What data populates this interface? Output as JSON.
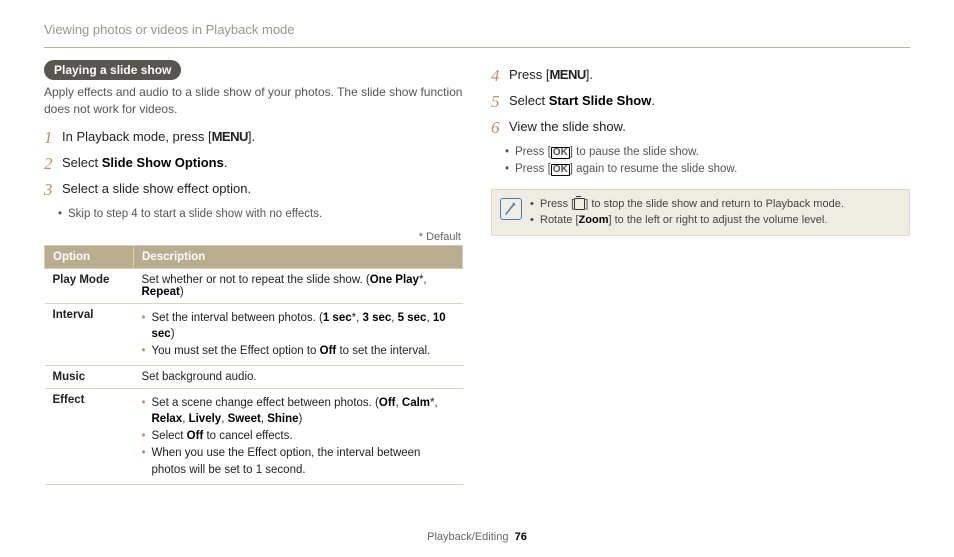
{
  "header": "Viewing photos or videos in Playback mode",
  "pill": "Playing a slide show",
  "intro": "Apply effects and audio to a slide show of your photos. The slide show function does not work for videos.",
  "glyphs": {
    "menu": "MENU",
    "ok": "OK"
  },
  "stepsL": {
    "s1": {
      "num": "1",
      "a": "In Playback mode, press [",
      "b": "]."
    },
    "s2": {
      "num": "2",
      "a": "Select ",
      "b": "Slide Show Options",
      "c": "."
    },
    "s3": {
      "num": "3",
      "a": "Select a slide show effect option.",
      "sub": "Skip to step 4 to start a slide show with no effects."
    }
  },
  "defnote": "* Default",
  "table": {
    "h1": "Option",
    "h2": "Description",
    "r1": {
      "o": "Play Mode",
      "a": "Set whether or not to repeat the slide show. (",
      "b": "One Play",
      "c": "*, ",
      "d": "Repeat",
      "e": ")"
    },
    "r2": {
      "o": "Interval",
      "l1a": "Set the interval between photos. (",
      "l1b": "1 sec",
      "l1c": "*, ",
      "l1d": "3 sec",
      "l1e": ", ",
      "l1f": "5 sec",
      "l1g": ", ",
      "l1h": "10 sec",
      "l1i": ")",
      "l2a": "You must set the Effect option to ",
      "l2b": "Off",
      "l2c": " to set the interval."
    },
    "r3": {
      "o": "Music",
      "d": "Set background audio."
    },
    "r4": {
      "o": "Effect",
      "l1a": "Set a scene change effect between photos. (",
      "l1b": "Off",
      "l1c": ", ",
      "l1d": "Calm",
      "l1e": "*, ",
      "l1f": "Relax",
      "l1g": ", ",
      "l1h": "Lively",
      "l1i": ", ",
      "l1j": "Sweet",
      "l1k": ", ",
      "l1l": "Shine",
      "l1m": ")",
      "l2a": "Select ",
      "l2b": "Off",
      "l2c": " to cancel effects.",
      "l3": "When you use the Effect option, the interval between photos will be set to 1 second."
    }
  },
  "stepsR": {
    "s4": {
      "num": "4",
      "a": "Press [",
      "b": "]."
    },
    "s5": {
      "num": "5",
      "a": "Select ",
      "b": "Start Slide Show",
      "c": "."
    },
    "s6": {
      "num": "6",
      "a": "View the slide show.",
      "sub1a": "Press [",
      "sub1b": "] to pause the slide show.",
      "sub2a": "Press [",
      "sub2b": "] again to resume the slide show."
    }
  },
  "note": {
    "l1a": "Press [",
    "l1b": "] to stop the slide show and return to Playback mode.",
    "l2a": "Rotate [",
    "l2b": "Zoom",
    "l2c": "] to the left or right to adjust the volume level."
  },
  "footer": {
    "section": "Playback/Editing",
    "page": "76"
  }
}
